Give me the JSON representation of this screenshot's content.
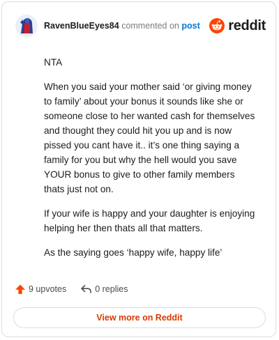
{
  "header": {
    "username": "RavenBlueEyes84",
    "action": "commented on",
    "post_link": "post",
    "brand": "reddit"
  },
  "comment": {
    "paragraphs": [
      "NTA",
      "When you said your mother said ‘or giving money to family’ about your bonus it sounds like she or someone close to her wanted cash for themselves and thought they could hit you up and is now pissed you cant have it.. it’s one thing saying a family for you but why the hell would you save YOUR bonus to give to other family members thats just not on.",
      "If your wife is happy and your daughter is enjoying helping her then thats all that matters.",
      "As the saying goes ‘happy wife, happy life’"
    ]
  },
  "footer": {
    "upvotes": "9 upvotes",
    "replies": "0 replies",
    "view_more": "View more on Reddit"
  },
  "colors": {
    "brand_orange": "#ff4500",
    "link_blue": "#0079d3",
    "cta_text": "#d93a00"
  },
  "icons": {
    "upvote": "upvote-arrow-icon",
    "reply": "reply-arrow-icon",
    "logo": "reddit-alien-icon"
  }
}
